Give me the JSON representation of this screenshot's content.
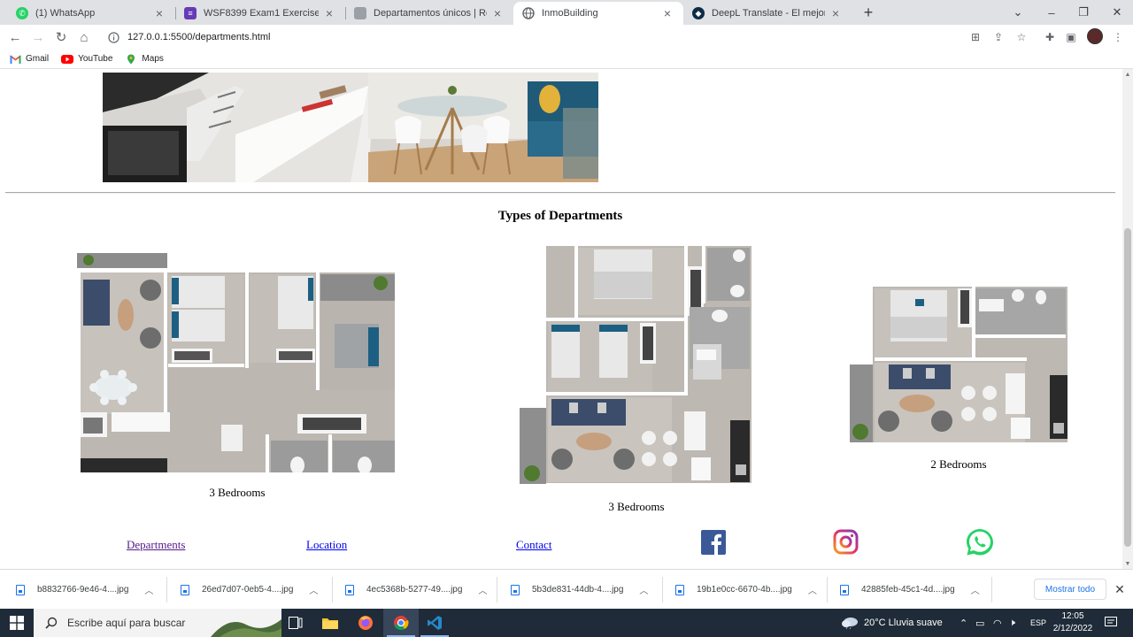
{
  "browser": {
    "tabs": [
      {
        "label": "(1) WhatsApp",
        "icon": "whatsapp-icon",
        "color": "#25d366"
      },
      {
        "label": "WSF8399 Exam1 Exercise",
        "icon": "form-icon",
        "color": "#673ab7"
      },
      {
        "label": "Departamentos únicos | Retamo",
        "icon": "page-icon",
        "color": "#9aa0a6"
      },
      {
        "label": "InmoBuilding",
        "icon": "globe-icon",
        "color": "#5f6368",
        "active": true
      },
      {
        "label": "DeepL Translate - El mejor tradu",
        "icon": "deepl-icon",
        "color": "#0f2b46"
      }
    ],
    "url": "127.0.0.1:5500/departments.html",
    "bookmarks": [
      {
        "label": "Gmail",
        "icon": "gmail-icon"
      },
      {
        "label": "YouTube",
        "icon": "youtube-icon"
      },
      {
        "label": "Maps",
        "icon": "maps-icon"
      }
    ]
  },
  "page": {
    "section_title": "Types of Departments",
    "plans": [
      {
        "caption": "3 Bedrooms"
      },
      {
        "caption": "3 Bedrooms"
      },
      {
        "caption": "2 Bedrooms"
      }
    ],
    "footer_links": [
      "Departments",
      "Location",
      "Contact"
    ],
    "social": [
      "facebook-icon",
      "instagram-icon",
      "whatsapp-icon"
    ],
    "colors": {
      "facebook": "#3b5998",
      "instagram": "#c13584",
      "whatsapp": "#25d366"
    }
  },
  "downloads": {
    "items": [
      "b8832766-9e46-4....jpg",
      "26ed7d07-0eb5-4....jpg",
      "4ec5368b-5277-49....jpg",
      "5b3de831-44db-4....jpg",
      "19b1e0cc-6670-4b....jpg",
      "42885feb-45c1-4d....jpg"
    ],
    "show_all": "Mostrar todo"
  },
  "taskbar": {
    "search_placeholder": "Escribe aquí para buscar",
    "weather": "20°C  Lluvia suave",
    "lang": "ESP",
    "time": "12:05",
    "date": "2/12/2022"
  }
}
